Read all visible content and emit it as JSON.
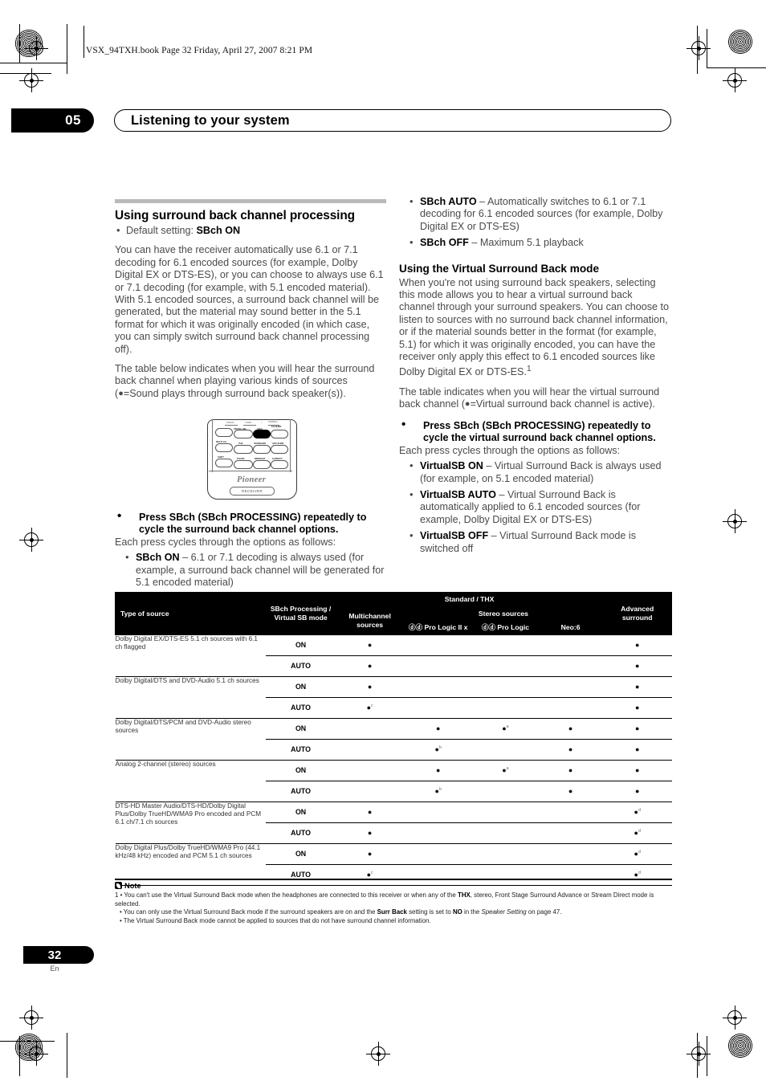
{
  "print_header": "VSX_94TXH.book  Page 32  Friday, April 27, 2007  8:21 PM",
  "chapter": {
    "number": "05",
    "title": "Listening to your system"
  },
  "left_column": {
    "heading": "Using surround back channel processing",
    "default_setting_prefix": "Default setting: ",
    "default_setting_value": "SBch ON",
    "para1": "You can have the receiver automatically use 6.1 or 7.1 decoding for 6.1 encoded sources (for example, Dolby Digital EX or DTS-ES), or you can choose to always use 6.1 or 7.1 decoding (for example, with 5.1 encoded material). With 5.1 encoded sources, a surround back channel will be generated, but the material may sound better in the 5.1 format for which it was originally encoded (in which case, you can simply switch surround back channel processing off).",
    "para2_a": "The table below indicates when you will hear the surround back channel when playing various kinds of sources (",
    "para2_b": "=Sound plays through surround back speaker(s)).",
    "press_instruction": "Press SBch (SBch PROCESSING) repeatedly to cycle the surround back channel options.",
    "cycle_lead": "Each press cycles through the options as follows:",
    "options": [
      {
        "name": "SBch ON",
        "desc": " – 6.1 or 7.1 decoding is always used (for example, a surround back channel will be generated for 5.1 encoded material)"
      }
    ]
  },
  "remote": {
    "brand": "Pioneer",
    "receiver_label": "RECEIVER",
    "top_labels": [
      "PHONO",
      "T DISP",
      "×◇",
      "STEREO/\nF.S.SURR"
    ],
    "buttons": [
      {
        "label": "STATUS",
        "dark": false
      },
      {
        "label": "SIGNAL SEL",
        "dark": false
      },
      {
        "label": "SBch",
        "dark": true
      },
      {
        "label": "F.S.SURR",
        "dark": false
      },
      {
        "label": "MULTI CH",
        "dark": false
      },
      {
        "label": "THX",
        "dark": false
      },
      {
        "label": "STANDARD",
        "dark": false
      },
      {
        "label": "ADV SURR",
        "dark": false
      },
      {
        "label": "SHIFT",
        "dark": false
      },
      {
        "label": "PHASE",
        "dark": false
      },
      {
        "label": "MIDNIGHT",
        "dark": false
      },
      {
        "label": "S.DIRECT",
        "dark": false
      }
    ]
  },
  "right_column": {
    "options_top": [
      {
        "name": "SBch AUTO",
        "desc": " – Automatically switches to 6.1 or 7.1 decoding for 6.1 encoded sources (for example, Dolby Digital EX or DTS-ES)"
      },
      {
        "name": "SBch OFF",
        "desc": " – Maximum 5.1 playback"
      }
    ],
    "heading": "Using the Virtual Surround Back mode",
    "para1_a": "When you're not using surround back speakers, selecting this mode allows you to hear a virtual surround back channel through your surround speakers. You can choose to listen to sources with no surround back channel information, or if the material sounds better in the format (for example, 5.1) for which it was originally encoded, you can have the receiver only apply this effect to 6.1 encoded sources like Dolby Digital EX or DTS-ES.",
    "para1_footnote": "1",
    "para2_a": "The table indicates when you will hear the virtual surround back channel (",
    "para2_b": "=Virtual surround back channel is active).",
    "press_instruction": "Press SBch (SBch PROCESSING) repeatedly to cycle the virtual surround back channel options.",
    "cycle_lead": "Each press cycles through the options as follows:",
    "options": [
      {
        "name": "VirtualSB ON",
        "desc": " – Virtual Surround Back is always used (for example, on 5.1 encoded material)"
      },
      {
        "name": "VirtualSB AUTO",
        "desc": " – Virtual Surround Back is automatically applied to 6.1 encoded sources (for example, Dolby Digital EX or DTS-ES)"
      },
      {
        "name": "VirtualSB OFF",
        "desc": " – Virtual Surround Back mode is switched off"
      }
    ]
  },
  "table": {
    "headers": {
      "type_of_source": "Type of source",
      "mode": "SBch Processing / Virtual SB mode",
      "standard_thx": "Standard / THX",
      "multichannel": "Multichannel sources",
      "stereo_sources": "Stereo sources",
      "pro_logic_iix": "Pro Logic II x",
      "pro_logic": "Pro Logic",
      "neo6": "Neo:6",
      "advanced": "Advanced surround"
    },
    "dot": "●",
    "dolby_mark": "ⓓⓓ",
    "rows": [
      {
        "source": "Dolby Digital EX/DTS-ES 5.1 ch sources with 6.1 ch flagged",
        "modes": [
          {
            "mode": "ON",
            "multichannel": "●",
            "plii": "",
            "pl": "",
            "neo6": "",
            "advanced": "●",
            "multichannel_sup": "",
            "plii_sup": "",
            "advanced_sup": ""
          },
          {
            "mode": "AUTO",
            "multichannel": "●",
            "plii": "",
            "pl": "",
            "neo6": "",
            "advanced": "●",
            "multichannel_sup": "",
            "plii_sup": "",
            "advanced_sup": ""
          }
        ]
      },
      {
        "source": "Dolby Digital/DTS and DVD-Audio 5.1 ch sources",
        "modes": [
          {
            "mode": "ON",
            "multichannel": "●",
            "plii": "",
            "pl": "",
            "neo6": "",
            "advanced": "●",
            "multichannel_sup": "",
            "plii_sup": "",
            "advanced_sup": ""
          },
          {
            "mode": "AUTO",
            "multichannel": "●",
            "plii": "",
            "pl": "",
            "neo6": "",
            "advanced": "●",
            "multichannel_sup": "c",
            "plii_sup": "",
            "advanced_sup": ""
          }
        ]
      },
      {
        "source": "Dolby Digital/DTS/PCM and DVD-Audio stereo sources",
        "modes": [
          {
            "mode": "ON",
            "multichannel": "",
            "plii": "●",
            "pl": "●",
            "neo6": "●",
            "advanced": "●",
            "multichannel_sup": "",
            "plii_sup": "",
            "pl_sup": "a",
            "advanced_sup": ""
          },
          {
            "mode": "AUTO",
            "multichannel": "",
            "plii": "●",
            "pl": "",
            "neo6": "●",
            "advanced": "●",
            "multichannel_sup": "",
            "plii_sup": "b",
            "advanced_sup": ""
          }
        ]
      },
      {
        "source": "Analog 2-channel (stereo) sources",
        "modes": [
          {
            "mode": "ON",
            "multichannel": "",
            "plii": "●",
            "pl": "●",
            "neo6": "●",
            "advanced": "●",
            "multichannel_sup": "",
            "plii_sup": "",
            "pl_sup": "a",
            "advanced_sup": ""
          },
          {
            "mode": "AUTO",
            "multichannel": "",
            "plii": "●",
            "pl": "",
            "neo6": "●",
            "advanced": "●",
            "multichannel_sup": "",
            "plii_sup": "b",
            "advanced_sup": ""
          }
        ]
      },
      {
        "source": "DTS-HD Master Audio/DTS-HD/Dolby Digital Plus/Dolby TrueHD/WMA9 Pro encoded and PCM 6.1 ch/7.1 ch sources",
        "modes": [
          {
            "mode": "ON",
            "multichannel": "●",
            "plii": "",
            "pl": "",
            "neo6": "",
            "advanced": "●",
            "multichannel_sup": "",
            "plii_sup": "",
            "advanced_sup": "d"
          },
          {
            "mode": "AUTO",
            "multichannel": "●",
            "plii": "",
            "pl": "",
            "neo6": "",
            "advanced": "●",
            "multichannel_sup": "",
            "plii_sup": "",
            "advanced_sup": "d"
          }
        ]
      },
      {
        "source": "Dolby Digital Plus/Dolby TrueHD/WMA9 Pro (44.1 kHz/48 kHz) encoded and PCM 5.1 ch sources",
        "modes": [
          {
            "mode": "ON",
            "multichannel": "●",
            "plii": "",
            "pl": "",
            "neo6": "",
            "advanced": "●",
            "multichannel_sup": "",
            "plii_sup": "",
            "advanced_sup": "d"
          },
          {
            "mode": "AUTO",
            "multichannel": "●",
            "plii": "",
            "pl": "",
            "neo6": "",
            "advanced": "●",
            "multichannel_sup": "c",
            "plii_sup": "",
            "advanced_sup": "d"
          }
        ]
      }
    ]
  },
  "note": {
    "title": "Note",
    "items": [
      "1 • You can't use the Virtual Surround Back mode when the headphones are connected to this receiver or when any of the THX, stereo, Front Stage Surround Advance or Stream Direct mode is selected.",
      "• You can only use the Virtual Surround Back mode if the surround speakers are on and the Surr Back setting is set to NO in the Speaker Setting on page 47.",
      "• The Virtual Surround Back mode cannot be applied to sources that do not have surround channel information."
    ]
  },
  "footer": {
    "page_number": "32",
    "language": "En"
  }
}
